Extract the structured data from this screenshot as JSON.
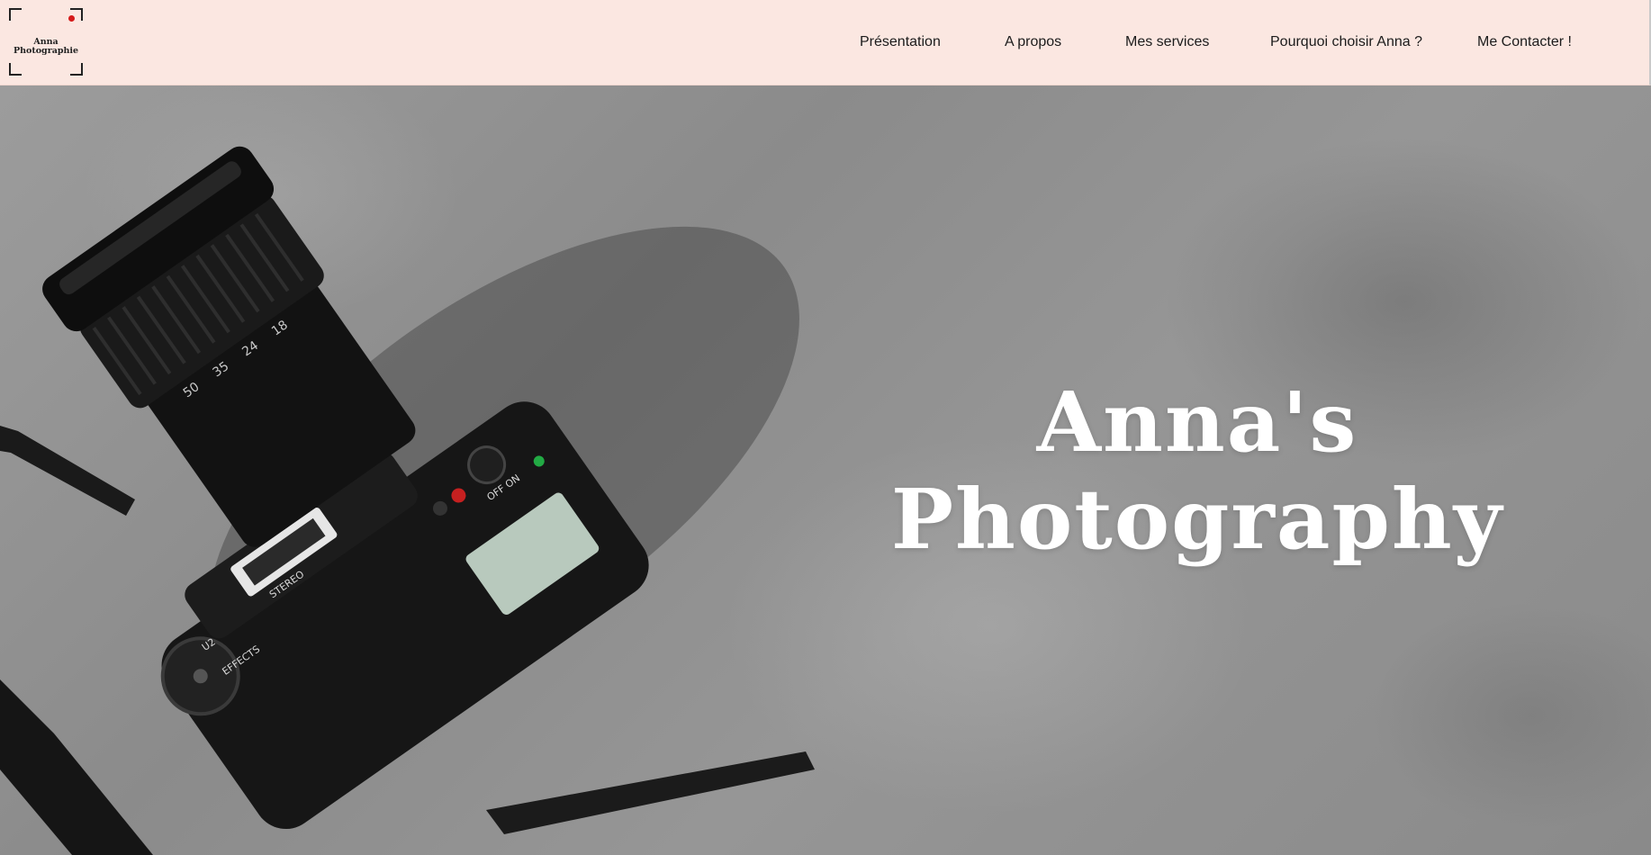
{
  "header": {
    "logo": {
      "line1": "Anna",
      "line2": "Photographie"
    },
    "nav": [
      {
        "label": "Présentation"
      },
      {
        "label": "A propos"
      },
      {
        "label": "Mes services"
      },
      {
        "label": "Pourquoi choisir Anna ?"
      },
      {
        "label": "Me Contacter !"
      }
    ]
  },
  "hero": {
    "title_line1": "Anna's",
    "title_line2": "Photography",
    "image": {
      "subject": "camera-with-lens-on-concrete",
      "lens_markings": [
        "50",
        "35",
        "24",
        "18"
      ],
      "dial_markings": [
        "U2",
        "EFFECTS"
      ],
      "power_label": "OFF ON",
      "flash_label": "STEREO"
    }
  },
  "colors": {
    "header_bg": "#fbe7e1",
    "text": "#1c1c1c",
    "hero_title": "#ffffff",
    "rec_dot": "#d51a1a"
  }
}
